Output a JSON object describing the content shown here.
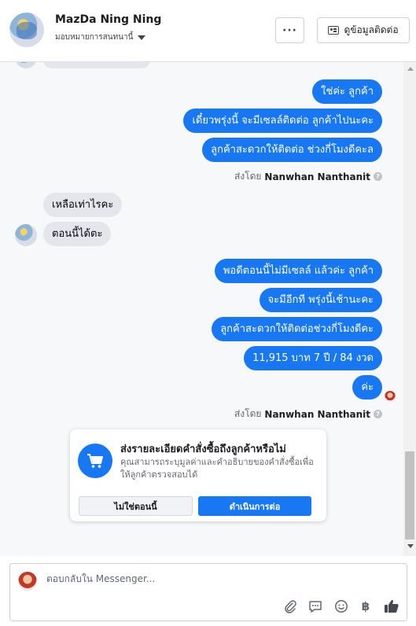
{
  "header": {
    "contact_name": "MazDa Ning Ning",
    "assign_label": "มอบหมายการสนทนานี้",
    "more_label": "···",
    "view_contact_label": "ดูข้อมูลติดต่อ"
  },
  "thread": {
    "out_group_1": [
      "ใช่ค่ะ ลูกค้า",
      "เดี๋ยวพรุ่งนี้ จะมีเซลล์ติดต่อ ลูกค้าไปนะคะ",
      "ลูกค้าสะดวกให้ติดต่อ ช่วงกี่โมงดีคะล"
    ],
    "sent_by_prefix": "ส่งโดย",
    "sender_name": "Nanwhan Nanthanit",
    "in_group": [
      "เหลือเท่าไรคะ",
      "ตอนนี้ได้ตะ"
    ],
    "out_group_2": [
      "พอดีตอนนี้ไม่มีเซลล์ แล้วค่ะ ลูกค้า",
      "จะมีอีกที พรุ่งนี้เช้านะคะ",
      "ลูกค้าสะดวกให้ติดต่อช่วงกี่โมงดีคะ",
      "11,915 บาท 7 ปี / 84 งวด",
      "ค่ะ"
    ]
  },
  "order_card": {
    "title": "ส่งรายละเอียดคำสั่งซื้อถึงลูกค้าหรือไม่",
    "description": "คุณสามารถระบุมูลค่าและคำอธิบายของคำสั่งซื้อเพื่อให้ลูกค้าตรวจสอบได้",
    "no_button": "ไม่ใช่ตอนนี้",
    "yes_button": "ดำเนินการต่อ"
  },
  "composer": {
    "placeholder": "ตอบกลับใน Messenger...",
    "tools": [
      "paperclip-icon",
      "chat-icon",
      "smiley-icon",
      "baht-icon",
      "thumbs-up-icon"
    ],
    "baht_symbol": "฿"
  },
  "colors": {
    "accent": "#1877f2",
    "incoming_bubble": "#e4e6eb",
    "thread_background": "#f7f8fa"
  }
}
